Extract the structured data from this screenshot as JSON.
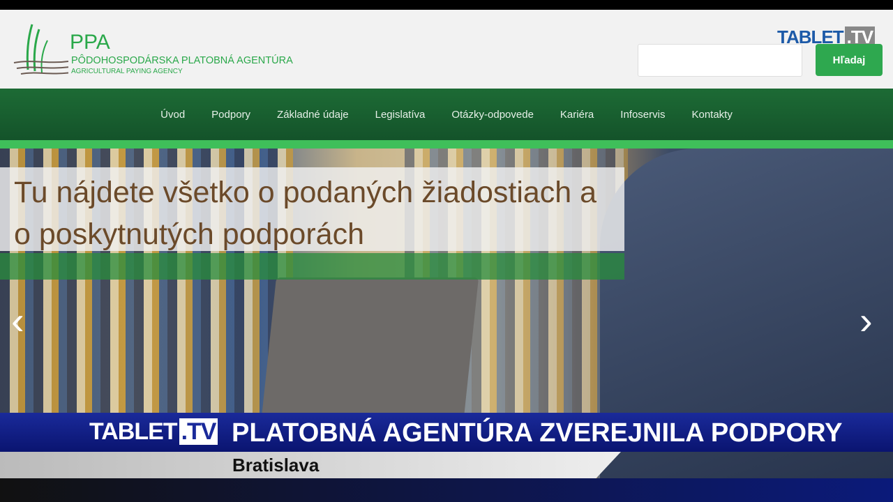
{
  "header": {
    "logo_short": "PPA",
    "logo_full": "PÔDOHOSPODÁRSKA PLATOBNÁ AGENTÚRA",
    "logo_english": "AGRICULTURAL PAYING AGENCY",
    "search_placeholder": "",
    "search_button": "Hľadaj"
  },
  "nav": [
    "Úvod",
    "Podpory",
    "Základné údaje",
    "Legislatíva",
    "Otázky-odpovede",
    "Kariéra",
    "Infoservis",
    "Kontakty"
  ],
  "hero": {
    "caption": "Tu nájdete všetko o podaných žiadostiach a o poskytnutých podporách",
    "prev": "‹",
    "next": "›"
  },
  "broadcast": {
    "watermark": "TABLET",
    "watermark_tv": ".TV",
    "brand": "TABLET",
    "brand_tv": ".TV",
    "headline": "PLATOBNÁ AGENTÚRA ZVEREJNILA PODPORY",
    "location": "Bratislava"
  }
}
